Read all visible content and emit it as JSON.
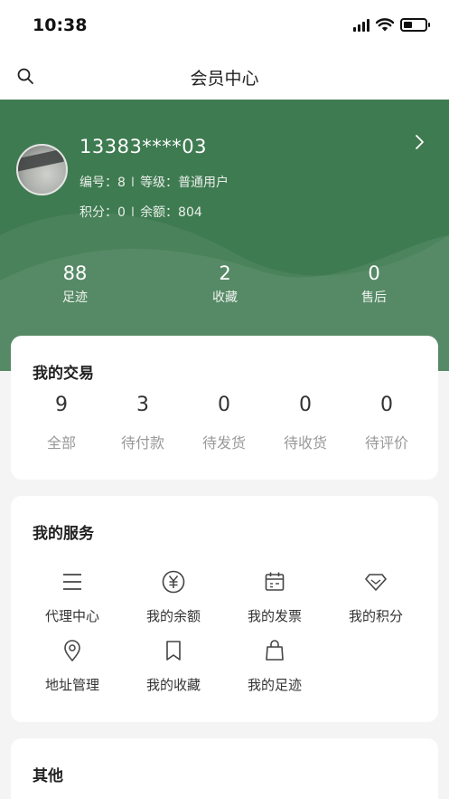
{
  "status": {
    "time": "10:38"
  },
  "nav": {
    "title": "会员中心"
  },
  "user": {
    "phone": "13383****03",
    "id_label": "编号：8",
    "level_label": "等级：",
    "level_value": "普通用户",
    "points_label": "积分：0",
    "balance_label": "余额：804",
    "separator": "I"
  },
  "stats": [
    {
      "value": "88",
      "label": "足迹"
    },
    {
      "value": "2",
      "label": "收藏"
    },
    {
      "value": "0",
      "label": "售后"
    }
  ],
  "trade": {
    "title": "我的交易",
    "items": [
      {
        "value": "9",
        "label": "全部"
      },
      {
        "value": "3",
        "label": "待付款"
      },
      {
        "value": "0",
        "label": "待发货"
      },
      {
        "value": "0",
        "label": "待收货"
      },
      {
        "value": "0",
        "label": "待评价"
      }
    ]
  },
  "services": {
    "title": "我的服务",
    "items": [
      {
        "label": "代理中心",
        "icon": "menu-lines-icon"
      },
      {
        "label": "我的余额",
        "icon": "yen-coin-icon"
      },
      {
        "label": "我的发票",
        "icon": "calendar-icon"
      },
      {
        "label": "我的积分",
        "icon": "diamond-icon"
      },
      {
        "label": "地址管理",
        "icon": "location-pin-icon"
      },
      {
        "label": "我的收藏",
        "icon": "bookmark-icon"
      },
      {
        "label": "我的足迹",
        "icon": "shopping-bag-icon"
      }
    ]
  },
  "other": {
    "title": "其他"
  },
  "colors": {
    "brand_green": "#3f7b51",
    "background": "#f4f4f4"
  }
}
